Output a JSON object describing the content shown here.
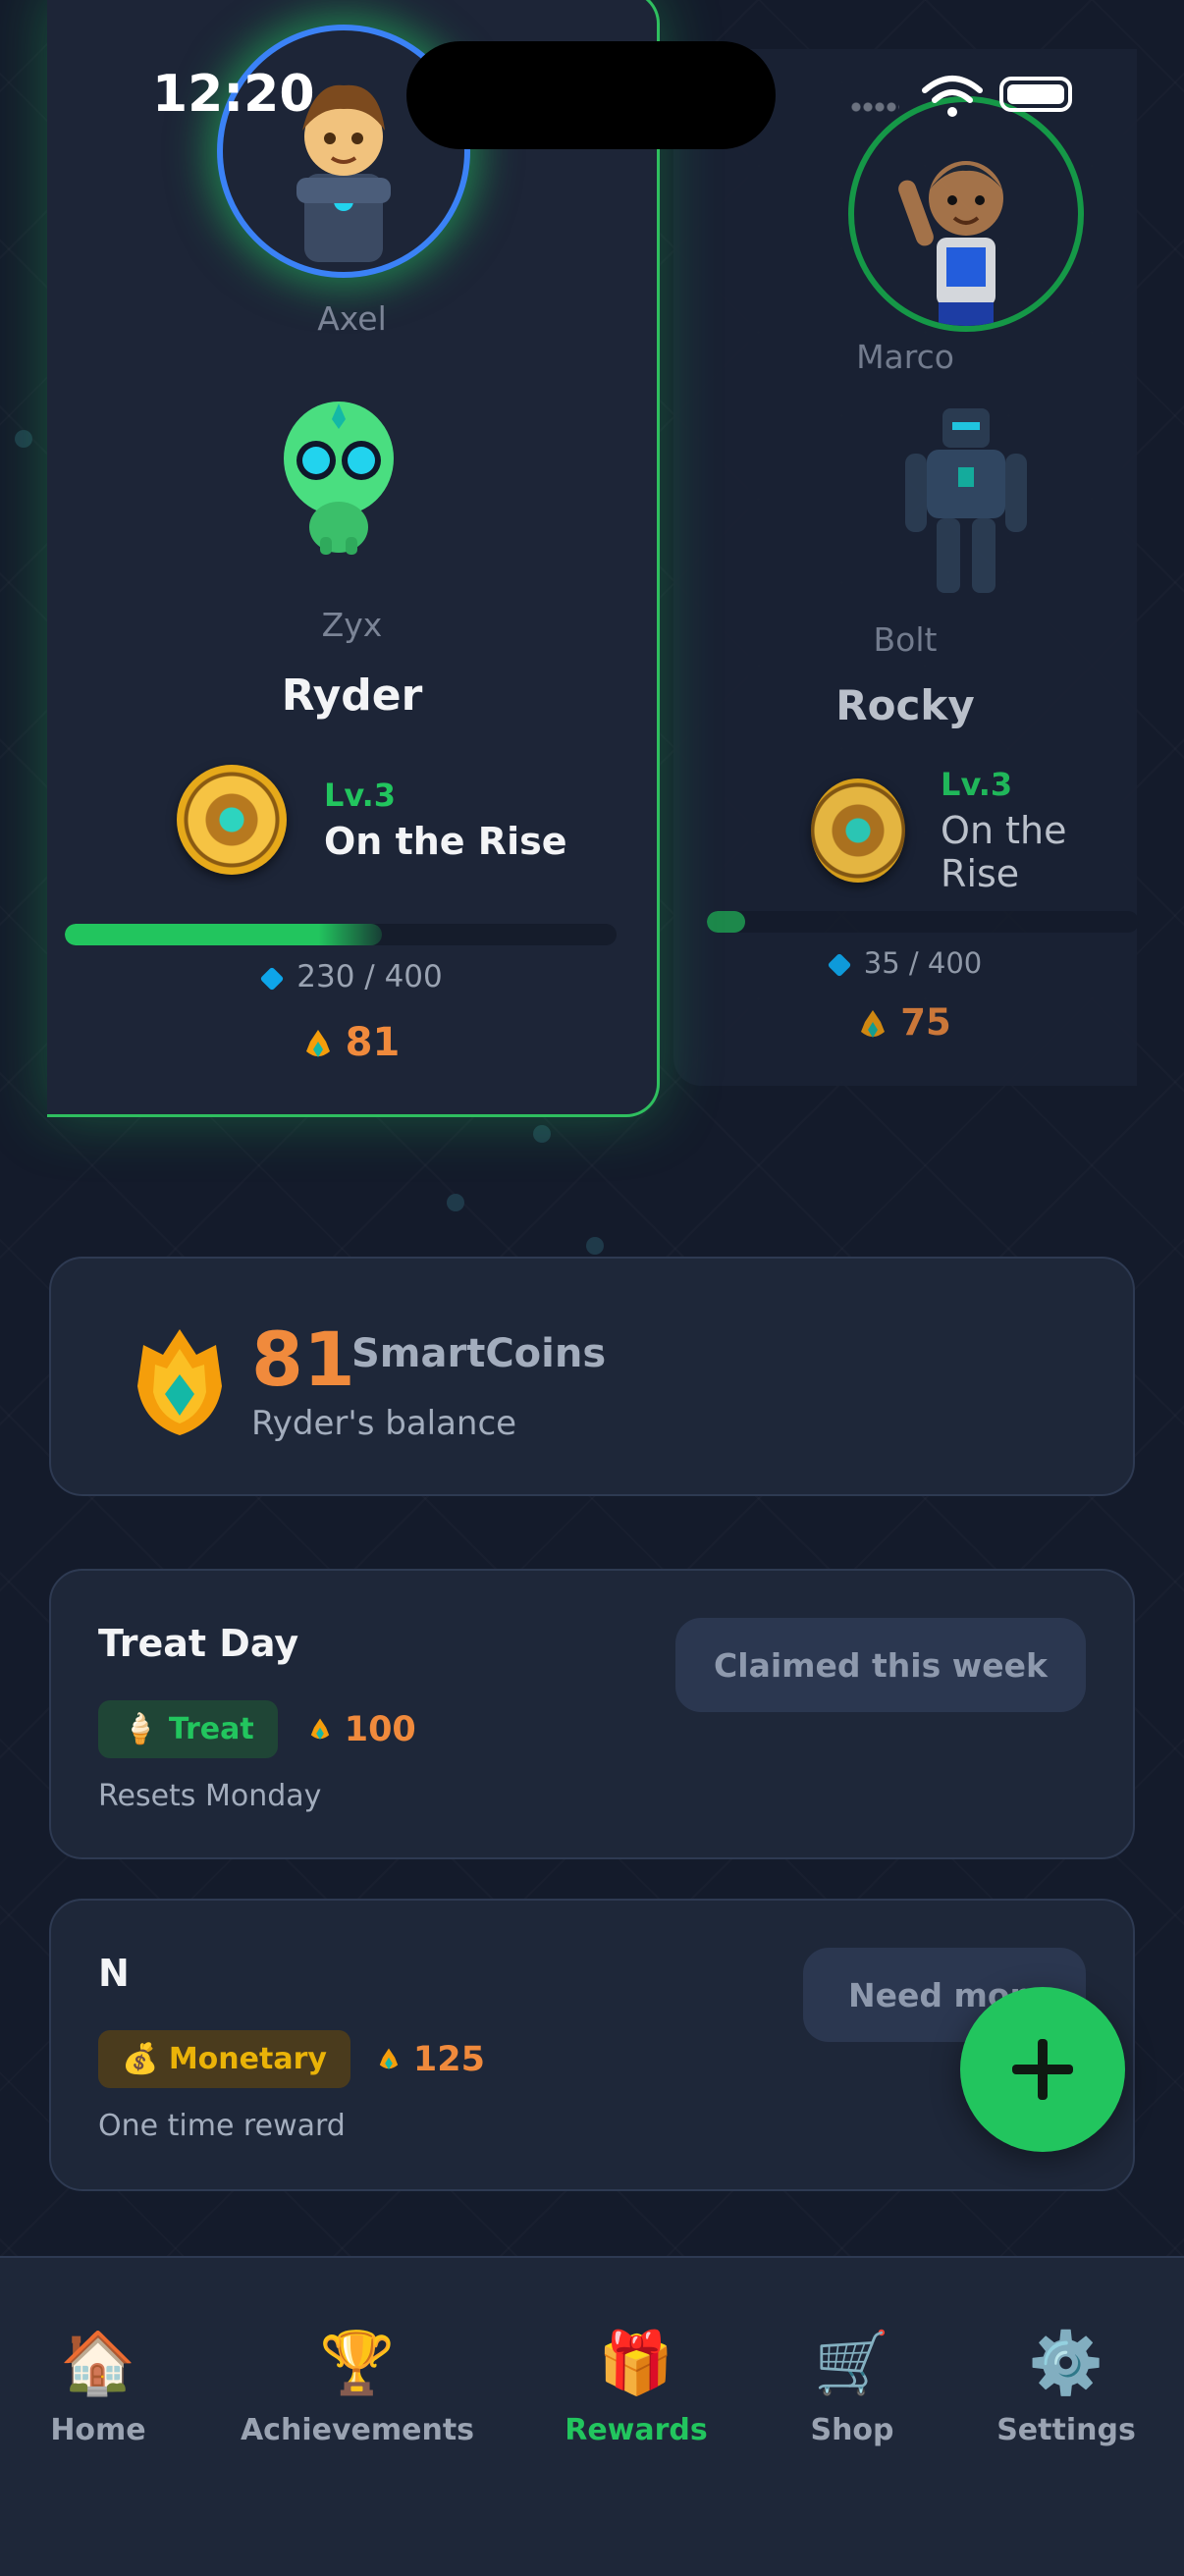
{
  "status": {
    "time": "12:20"
  },
  "kids": [
    {
      "avatar_name": "Axel",
      "pet_name": "Zyx",
      "name": "Ryder",
      "level": "Lv.3",
      "rank": "On the Rise",
      "xp_text": "230 / 400",
      "xp_progress": 0.575,
      "coins": "81",
      "selected": true
    },
    {
      "avatar_name": "Marco",
      "pet_name": "Bolt",
      "name": "Rocky",
      "level": "Lv.3",
      "rank": "On the Rise",
      "xp_text": "35 / 400",
      "xp_progress": 0.0875,
      "coins": "75",
      "selected": false
    }
  ],
  "balance": {
    "amount": "81",
    "unit": "SmartCoins",
    "subtitle": "Ryder's balance"
  },
  "rewards": [
    {
      "title": "Treat Day",
      "tag_icon": "🍦",
      "tag": "Treat",
      "cost": "100",
      "subtitle": "Resets Monday",
      "button": "Claimed this week"
    },
    {
      "title": "N",
      "tag_icon": "💰",
      "tag": "Monetary",
      "cost": "125",
      "subtitle": "One time reward",
      "button": "Need more"
    }
  ],
  "tabs": [
    {
      "label": "Home",
      "icon": "🏠",
      "active": false
    },
    {
      "label": "Achievements",
      "icon": "🏆",
      "active": false
    },
    {
      "label": "Rewards",
      "icon": "🎁",
      "active": true
    },
    {
      "label": "Shop",
      "icon": "🛒",
      "active": false
    },
    {
      "label": "Settings",
      "icon": "⚙️",
      "active": false
    }
  ],
  "colors": {
    "accent": "#22c55e",
    "coin": "#f08a3c",
    "background": "#141b2b",
    "card": "#1e2739"
  }
}
